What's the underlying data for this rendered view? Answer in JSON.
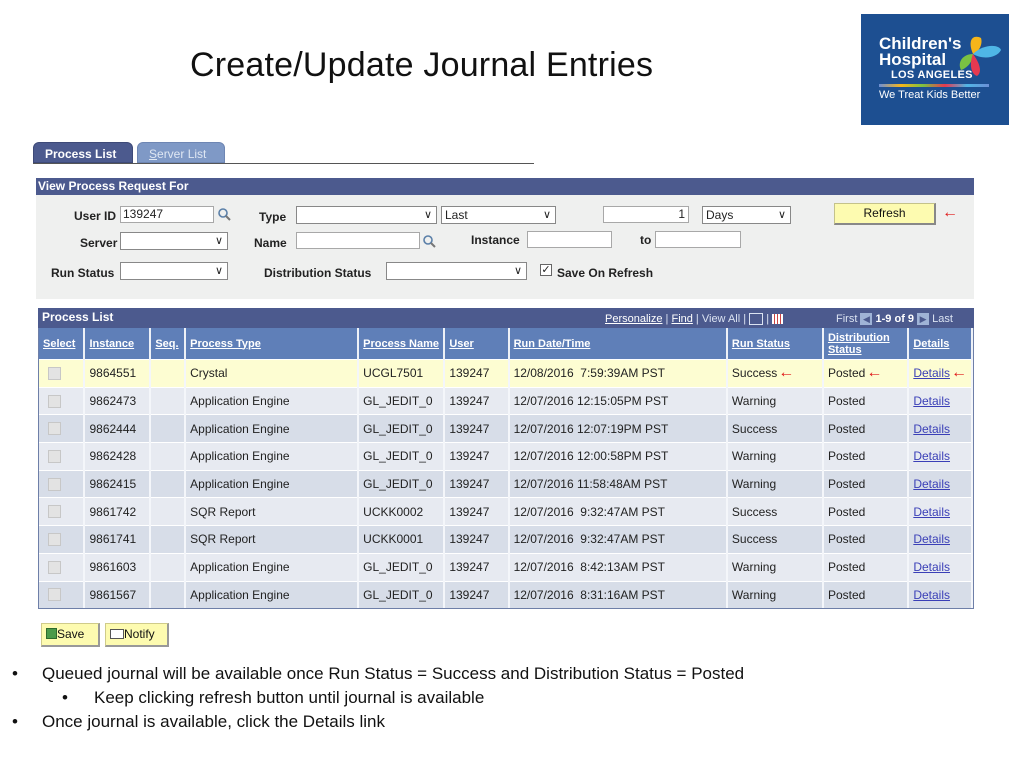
{
  "slide": {
    "title": "Create/Update Journal Entries",
    "logo": {
      "line1": "Children's",
      "line2": "Hospital",
      "line3": "LOS ANGELES",
      "tagline": "We Treat Kids Better"
    },
    "bullets": [
      {
        "level": 1,
        "text": "Queued journal will be available once Run Status = Success and Distribution Status = Posted"
      },
      {
        "level": 2,
        "text": "Keep clicking refresh button until journal is available"
      },
      {
        "level": 1,
        "text": "Once journal is available, click the Details link"
      }
    ]
  },
  "tabs": [
    {
      "label": "Process List",
      "active": true
    },
    {
      "label_first": "S",
      "label_rest": "erver List",
      "active": false
    }
  ],
  "criteria": {
    "header": "View Process Request For",
    "user_id_label": "User ID",
    "user_id_value": "139247",
    "type_label": "Type",
    "type_value": "",
    "last_value": "Last",
    "count_value": "1",
    "unit_value": "Days",
    "refresh_label": "Refresh",
    "server_label": "Server",
    "server_value": "",
    "name_label": "Name",
    "name_value": "",
    "instance_label": "Instance",
    "instance_from": "",
    "to_label": "to",
    "instance_to": "",
    "run_status_label": "Run Status",
    "run_status_value": "",
    "dist_status_label": "Distribution Status",
    "dist_status_value": "",
    "save_on_refresh_label": "Save On Refresh",
    "save_on_refresh_checked": true
  },
  "grid": {
    "title": "Process List",
    "nav": {
      "personalize": "Personalize",
      "find": "Find",
      "view_all": "View All",
      "first": "First",
      "range": "1-9 of 9",
      "last": "Last"
    },
    "columns": [
      "Select",
      "Instance",
      "Seq.",
      "Process Type",
      "Process Name",
      "User",
      "Run Date/Time",
      "Run Status",
      "Distribution Status",
      "Details"
    ],
    "rows": [
      {
        "instance": "9864551",
        "seq": "",
        "process_type": "Crystal",
        "process_name": "UCGL7501",
        "user": "139247",
        "run_datetime": "12/08/2016  7:59:39AM PST",
        "run_status": "Success",
        "dist_status": "Posted",
        "details": "Details"
      },
      {
        "instance": "9862473",
        "seq": "",
        "process_type": "Application Engine",
        "process_name": "GL_JEDIT_0",
        "user": "139247",
        "run_datetime": "12/07/2016 12:15:05PM PST",
        "run_status": "Warning",
        "dist_status": "Posted",
        "details": "Details"
      },
      {
        "instance": "9862444",
        "seq": "",
        "process_type": "Application Engine",
        "process_name": "GL_JEDIT_0",
        "user": "139247",
        "run_datetime": "12/07/2016 12:07:19PM PST",
        "run_status": "Success",
        "dist_status": "Posted",
        "details": "Details"
      },
      {
        "instance": "9862428",
        "seq": "",
        "process_type": "Application Engine",
        "process_name": "GL_JEDIT_0",
        "user": "139247",
        "run_datetime": "12/07/2016 12:00:58PM PST",
        "run_status": "Warning",
        "dist_status": "Posted",
        "details": "Details"
      },
      {
        "instance": "9862415",
        "seq": "",
        "process_type": "Application Engine",
        "process_name": "GL_JEDIT_0",
        "user": "139247",
        "run_datetime": "12/07/2016 11:58:48AM PST",
        "run_status": "Warning",
        "dist_status": "Posted",
        "details": "Details"
      },
      {
        "instance": "9861742",
        "seq": "",
        "process_type": "SQR Report",
        "process_name": "UCKK0002",
        "user": "139247",
        "run_datetime": "12/07/2016  9:32:47AM PST",
        "run_status": "Success",
        "dist_status": "Posted",
        "details": "Details"
      },
      {
        "instance": "9861741",
        "seq": "",
        "process_type": "SQR Report",
        "process_name": "UCKK0001",
        "user": "139247",
        "run_datetime": "12/07/2016  9:32:47AM PST",
        "run_status": "Success",
        "dist_status": "Posted",
        "details": "Details"
      },
      {
        "instance": "9861603",
        "seq": "",
        "process_type": "Application Engine",
        "process_name": "GL_JEDIT_0",
        "user": "139247",
        "run_datetime": "12/07/2016  8:42:13AM PST",
        "run_status": "Warning",
        "dist_status": "Posted",
        "details": "Details"
      },
      {
        "instance": "9861567",
        "seq": "",
        "process_type": "Application Engine",
        "process_name": "GL_JEDIT_0",
        "user": "139247",
        "run_datetime": "12/07/2016  8:31:16AM PST",
        "run_status": "Warning",
        "dist_status": "Posted",
        "details": "Details"
      }
    ]
  },
  "buttons": {
    "save": "Save",
    "notify": "Notify"
  },
  "annotations": {
    "arrow_glyph": "←",
    "arrow_color": "#e01818"
  },
  "colors": {
    "header_navy": "#4c5a8e",
    "column_header": "#5f7fb8",
    "button_yellow": "#fdfbb0",
    "highlight_row": "#fdfdd2",
    "logo_blue": "#1d4f91"
  }
}
